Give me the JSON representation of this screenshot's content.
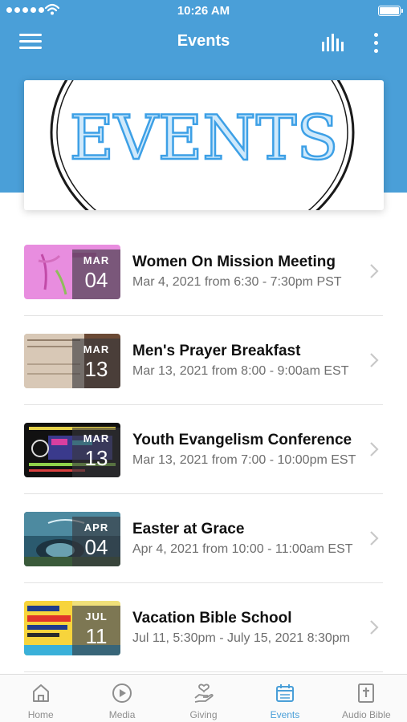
{
  "status_bar": {
    "time": "10:26 AM"
  },
  "header": {
    "title": "Events"
  },
  "banner": {
    "text": "EVENTS"
  },
  "events": [
    {
      "title": "Women On Mission Meeting",
      "subtitle": "Mar 4, 2021 from 6:30 - 7:30pm PST",
      "month": "MAR",
      "day": "04"
    },
    {
      "title": "Men's Prayer Breakfast",
      "subtitle": "Mar 13, 2021 from 8:00 - 9:00am EST",
      "month": "MAR",
      "day": "13"
    },
    {
      "title": "Youth Evangelism Conference",
      "subtitle": "Mar 13, 2021 from 7:00 - 10:00pm EST",
      "month": "MAR",
      "day": "13"
    },
    {
      "title": "Easter at Grace",
      "subtitle": "Apr 4, 2021 from 10:00 - 11:00am EST",
      "month": "APR",
      "day": "04"
    },
    {
      "title": "Vacation Bible School",
      "subtitle": "Jul 11, 5:30pm - July 15, 2021 8:30pm",
      "month": "JUL",
      "day": "11"
    }
  ],
  "tabs": [
    {
      "label": "Home",
      "icon": "home-icon"
    },
    {
      "label": "Media",
      "icon": "play-icon"
    },
    {
      "label": "Giving",
      "icon": "giving-hand-icon"
    },
    {
      "label": "Events",
      "icon": "calendar-icon",
      "active": true
    },
    {
      "label": "Audio Bible",
      "icon": "bible-icon"
    }
  ],
  "colors": {
    "accent": "#4a9fd8",
    "inactive": "#8e8e8e"
  }
}
